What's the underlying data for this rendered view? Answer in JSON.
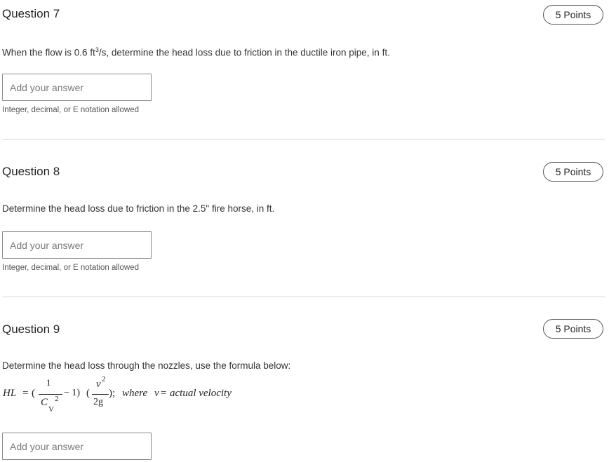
{
  "questions": [
    {
      "title": "Question 7",
      "points": "5 Points",
      "text_before_sup": "When the flow is 0.6 ft",
      "text_sup": "3",
      "text_after_sup": "/s, determine the head loss due to friction in the ductile iron pipe, in ft.",
      "placeholder": "Add your answer",
      "hint": "Integer, decimal, or E notation allowed"
    },
    {
      "title": "Question 8",
      "points": "5 Points",
      "text": "Determine the head loss due to friction in the 2.5\" fire horse, in ft.",
      "placeholder": "Add your answer",
      "hint": "Integer, decimal, or E notation allowed"
    },
    {
      "title": "Question 9",
      "points": "5 Points",
      "text": "Determine the head loss through the nozzles, use the formula below:",
      "placeholder": "Add your answer",
      "formula": {
        "lhs": "HL",
        "equals": "=",
        "open_paren_1": "(",
        "numerator_1": "1",
        "denominator_1": "C",
        "denominator_1_sup": "2",
        "denominator_1_sub": "V",
        "minus_one": "− 1)",
        "open_paren_2": "(",
        "numerator_2": "v",
        "numerator_2_sup": "2",
        "denominator_2": "2g",
        "close_paren_2": ");",
        "where_text": "where",
        "v_var": "v",
        "eq2": "=",
        "velocity_text": "actual velocity"
      }
    }
  ]
}
